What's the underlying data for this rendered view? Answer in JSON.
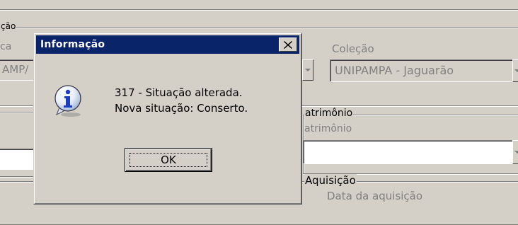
{
  "background": {
    "situacao_legend": "ção",
    "biblioteca_label": "ca",
    "biblioteca_value": "AMP/",
    "colecao_label": "Coleção",
    "colecao_value": "UNIPAMPA - Jaguarão",
    "patrimonio_legend": "atrimônio",
    "patrimonio_label": "atrimônio",
    "aquisicao_legend": "Aquisição",
    "data_aquisicao_label": "Data da aquisição"
  },
  "dialog": {
    "title": "Informação",
    "message_line1": "317 - Situação alterada.",
    "message_line2": "Nova situação: Conserto.",
    "ok_label": "OK",
    "icon": "info-icon",
    "titlebar_color": "#0a246a"
  }
}
